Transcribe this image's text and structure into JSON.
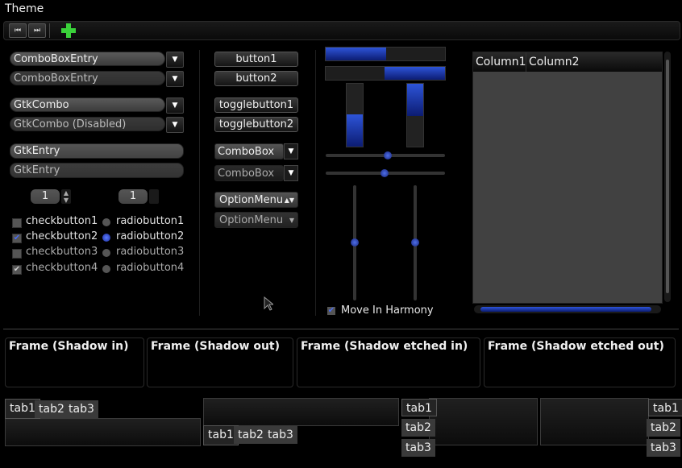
{
  "window": {
    "title": "Theme"
  },
  "toolbar": {
    "items": [
      "prev-icon",
      "next-icon",
      "add-icon"
    ]
  },
  "combos": [
    {
      "label": "ComboBoxEntry"
    },
    {
      "label": "ComboBoxEntry"
    },
    {
      "label": "GtkCombo"
    },
    {
      "label": "GtkCombo (Disabled)"
    }
  ],
  "entries": [
    "GtkEntry",
    "GtkEntry"
  ],
  "spins": [
    "1",
    "1"
  ],
  "checks": [
    "checkbutton1",
    "checkbutton2",
    "checkbutton3",
    "checkbutton4"
  ],
  "radios": [
    "radiobutton1",
    "radiobutton2",
    "radiobutton3",
    "radiobutton4"
  ],
  "buttons": [
    "button1",
    "button2",
    "togglebutton1",
    "togglebutton2"
  ],
  "comboboxes": [
    "ComboBox",
    "ComboBox"
  ],
  "optionmenus": [
    "OptionMenu",
    "OptionMenu"
  ],
  "harmony": {
    "label": "Move In Harmony",
    "checked": true
  },
  "tree": {
    "columns": [
      "Column1",
      "Column2"
    ]
  },
  "frames": [
    "Frame (Shadow in)",
    "Frame (Shadow out)",
    "Frame (Shadow etched in)",
    "Frame (Shadow etched out)"
  ],
  "tabs": [
    "tab1",
    "tab2",
    "tab3"
  ],
  "colors": {
    "accent": "#2d54d8"
  }
}
